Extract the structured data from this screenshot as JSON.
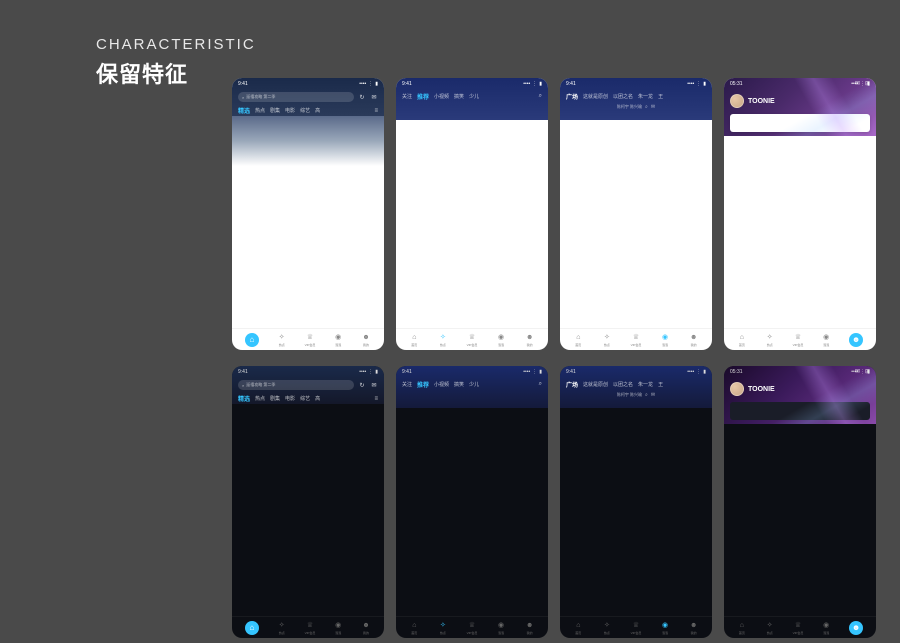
{
  "header": {
    "subtitle": "CHARACTERISTIC",
    "title": "保留特征"
  },
  "common": {
    "status_time": "9:41",
    "status_time_alt": "05:31"
  },
  "screens": [
    {
      "id": "home-light",
      "theme": "light",
      "status_time": "9:41",
      "search_placeholder": "延禧攻略 第二季",
      "tabs": [
        "精选",
        "热点",
        "剧集",
        "电影",
        "综艺",
        "高"
      ],
      "active_tab_index": 0,
      "nav": [
        {
          "icon": "home",
          "label": "首页",
          "active": true,
          "fab": true
        },
        {
          "icon": "spark",
          "label": "热点"
        },
        {
          "icon": "crown",
          "label": "VIP会员"
        },
        {
          "icon": "bubble",
          "label": "泡泡"
        },
        {
          "icon": "user",
          "label": "我的"
        }
      ]
    },
    {
      "id": "recommend-light",
      "theme": "light",
      "status_time": "9:41",
      "tabs": [
        "关注",
        "推荐",
        "小视频",
        "搞笑",
        "少儿"
      ],
      "active_tab_index": 1,
      "nav": [
        {
          "icon": "home",
          "label": "首页"
        },
        {
          "icon": "spark",
          "label": "热点",
          "active": true
        },
        {
          "icon": "crown",
          "label": "VIP会员"
        },
        {
          "icon": "bubble",
          "label": "泡泡"
        },
        {
          "icon": "user",
          "label": "我的"
        }
      ]
    },
    {
      "id": "square-light",
      "theme": "light",
      "status_time": "9:41",
      "tabs": [
        "广场",
        "这就是原创",
        "以团之名",
        "朱一龙",
        "王"
      ],
      "active_tab_index": 0,
      "subbar": "陈柯宇  陈兴瑜",
      "nav": [
        {
          "icon": "home",
          "label": "首页"
        },
        {
          "icon": "spark",
          "label": "热点"
        },
        {
          "icon": "crown",
          "label": "VIP会员"
        },
        {
          "icon": "bubble",
          "label": "泡泡",
          "active": true
        },
        {
          "icon": "user",
          "label": "我的"
        }
      ]
    },
    {
      "id": "profile-light",
      "theme": "light",
      "status_time": "05:31",
      "username": "TOONIE",
      "nav": [
        {
          "icon": "home",
          "label": "首页"
        },
        {
          "icon": "spark",
          "label": "热点"
        },
        {
          "icon": "crown",
          "label": "VIP会员"
        },
        {
          "icon": "bubble",
          "label": "泡泡"
        },
        {
          "icon": "user",
          "label": "我的",
          "active": true,
          "fab": true
        }
      ]
    },
    {
      "id": "home-dark",
      "theme": "dark",
      "status_time": "9:41",
      "search_placeholder": "延禧攻略 第二季",
      "tabs": [
        "精选",
        "热点",
        "剧集",
        "电影",
        "综艺",
        "高"
      ],
      "active_tab_index": 0,
      "nav": [
        {
          "icon": "home",
          "label": "首页",
          "active": true,
          "fab": true
        },
        {
          "icon": "spark",
          "label": "热点"
        },
        {
          "icon": "crown",
          "label": "VIP会员"
        },
        {
          "icon": "bubble",
          "label": "泡泡"
        },
        {
          "icon": "user",
          "label": "我的"
        }
      ]
    },
    {
      "id": "recommend-dark",
      "theme": "dark",
      "status_time": "9:41",
      "tabs": [
        "关注",
        "推荐",
        "小视频",
        "搞笑",
        "少儿"
      ],
      "active_tab_index": 1,
      "nav": [
        {
          "icon": "home",
          "label": "首页"
        },
        {
          "icon": "spark",
          "label": "热点",
          "active": true
        },
        {
          "icon": "crown",
          "label": "VIP会员"
        },
        {
          "icon": "bubble",
          "label": "泡泡"
        },
        {
          "icon": "user",
          "label": "我的"
        }
      ]
    },
    {
      "id": "square-dark",
      "theme": "dark",
      "status_time": "9:41",
      "tabs": [
        "广场",
        "这就是原创",
        "以团之名",
        "朱一龙",
        "王"
      ],
      "active_tab_index": 0,
      "subbar": "陈柯宇  陈兴瑜",
      "nav": [
        {
          "icon": "home",
          "label": "首页"
        },
        {
          "icon": "spark",
          "label": "热点"
        },
        {
          "icon": "crown",
          "label": "VIP会员"
        },
        {
          "icon": "bubble",
          "label": "泡泡",
          "active": true
        },
        {
          "icon": "user",
          "label": "我的"
        }
      ]
    },
    {
      "id": "profile-dark",
      "theme": "dark",
      "status_time": "05:31",
      "username": "TOONIE",
      "nav": [
        {
          "icon": "home",
          "label": "首页"
        },
        {
          "icon": "spark",
          "label": "热点"
        },
        {
          "icon": "crown",
          "label": "VIP会员"
        },
        {
          "icon": "bubble",
          "label": "泡泡"
        },
        {
          "icon": "user",
          "label": "我的",
          "active": true,
          "fab": true
        }
      ]
    }
  ],
  "icons": {
    "home": "⌂",
    "spark": "✧",
    "crown": "♕",
    "bubble": "◉",
    "user": "☻",
    "search": "⌕",
    "history": "↻",
    "msg": "✉",
    "scan": "⊞",
    "more": "≡"
  }
}
